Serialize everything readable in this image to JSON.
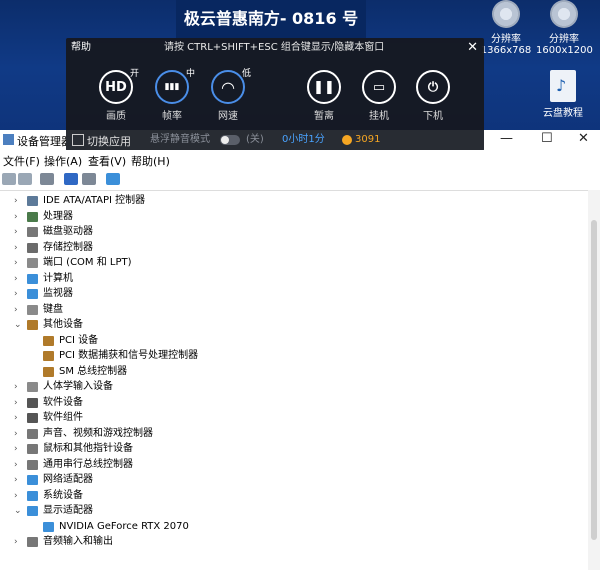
{
  "desktop": {
    "banner": "极云普惠南方- 0816 号",
    "icons": [
      {
        "label1": "分辨率",
        "label2": "1366x768",
        "icon": "gear-icon"
      },
      {
        "label1": "分辨率",
        "label2": "1600x1200",
        "icon": "gear-icon"
      },
      {
        "label1": "云盘教程",
        "label2": "",
        "icon": "cloud-disk-icon"
      }
    ]
  },
  "overlay": {
    "help": "帮助",
    "hint": "请按 CTRL+SHIFT+ESC 组合键显示/隐藏本窗口",
    "close": "✕",
    "buttons": [
      {
        "glyph": "HD",
        "badge": "开",
        "label": "画质"
      },
      {
        "glyph": "▮▮▮",
        "badge": "中",
        "label": "帧率"
      },
      {
        "glyph": "◠",
        "badge": "低",
        "label": "网速"
      },
      {
        "glyph": "❚❚",
        "badge": "",
        "label": "暂离"
      },
      {
        "glyph": "▭",
        "badge": "",
        "label": "挂机"
      },
      {
        "glyph": "⏻",
        "badge": "",
        "label": "下机"
      }
    ],
    "bottom": {
      "switch_app": "切换应用",
      "mode_text": "悬浮静音模式",
      "toggle_state": "(关)",
      "timer": "0小时1分",
      "coins": "3091"
    }
  },
  "window": {
    "title": "设备管理器",
    "min": "—",
    "max": "☐",
    "close": "✕"
  },
  "menu": [
    "文件(F)",
    "操作(A)",
    "查看(V)",
    "帮助(H)"
  ],
  "tree": [
    {
      "level": 1,
      "expanded": false,
      "label": "IDE ATA/ATAPI 控制器",
      "color": "#5d7a99"
    },
    {
      "level": 1,
      "expanded": false,
      "label": "处理器",
      "color": "#4a7a4a"
    },
    {
      "level": 1,
      "expanded": false,
      "label": "磁盘驱动器",
      "color": "#777777"
    },
    {
      "level": 1,
      "expanded": false,
      "label": "存储控制器",
      "color": "#6b6b6b"
    },
    {
      "level": 1,
      "expanded": false,
      "label": "端口 (COM 和 LPT)",
      "color": "#8a8a8a"
    },
    {
      "level": 1,
      "expanded": false,
      "label": "计算机",
      "color": "#3b8fd9"
    },
    {
      "level": 1,
      "expanded": false,
      "label": "监视器",
      "color": "#3b8fd9"
    },
    {
      "level": 1,
      "expanded": false,
      "label": "键盘",
      "color": "#8a8a8a"
    },
    {
      "level": 1,
      "expanded": true,
      "label": "其他设备",
      "color": "#b07a2a"
    },
    {
      "level": 2,
      "expanded": null,
      "label": "PCI 设备",
      "color": "#b07a2a"
    },
    {
      "level": 2,
      "expanded": null,
      "label": "PCI 数据捕获和信号处理控制器",
      "color": "#b07a2a"
    },
    {
      "level": 2,
      "expanded": null,
      "label": "SM 总线控制器",
      "color": "#b07a2a"
    },
    {
      "level": 1,
      "expanded": false,
      "label": "人体学输入设备",
      "color": "#8a8a8a"
    },
    {
      "level": 1,
      "expanded": false,
      "label": "软件设备",
      "color": "#555555"
    },
    {
      "level": 1,
      "expanded": false,
      "label": "软件组件",
      "color": "#555555"
    },
    {
      "level": 1,
      "expanded": false,
      "label": "声音、视频和游戏控制器",
      "color": "#777777"
    },
    {
      "level": 1,
      "expanded": false,
      "label": "鼠标和其他指针设备",
      "color": "#777777"
    },
    {
      "level": 1,
      "expanded": false,
      "label": "通用串行总线控制器",
      "color": "#777777"
    },
    {
      "level": 1,
      "expanded": false,
      "label": "网络适配器",
      "color": "#3b8fd9"
    },
    {
      "level": 1,
      "expanded": false,
      "label": "系统设备",
      "color": "#3b8fd9"
    },
    {
      "level": 1,
      "expanded": true,
      "label": "显示适配器",
      "color": "#3b8fd9"
    },
    {
      "level": 2,
      "expanded": null,
      "label": "NVIDIA GeForce RTX 2070",
      "color": "#3b8fd9"
    },
    {
      "level": 1,
      "expanded": false,
      "label": "音频输入和输出",
      "color": "#777777"
    }
  ]
}
